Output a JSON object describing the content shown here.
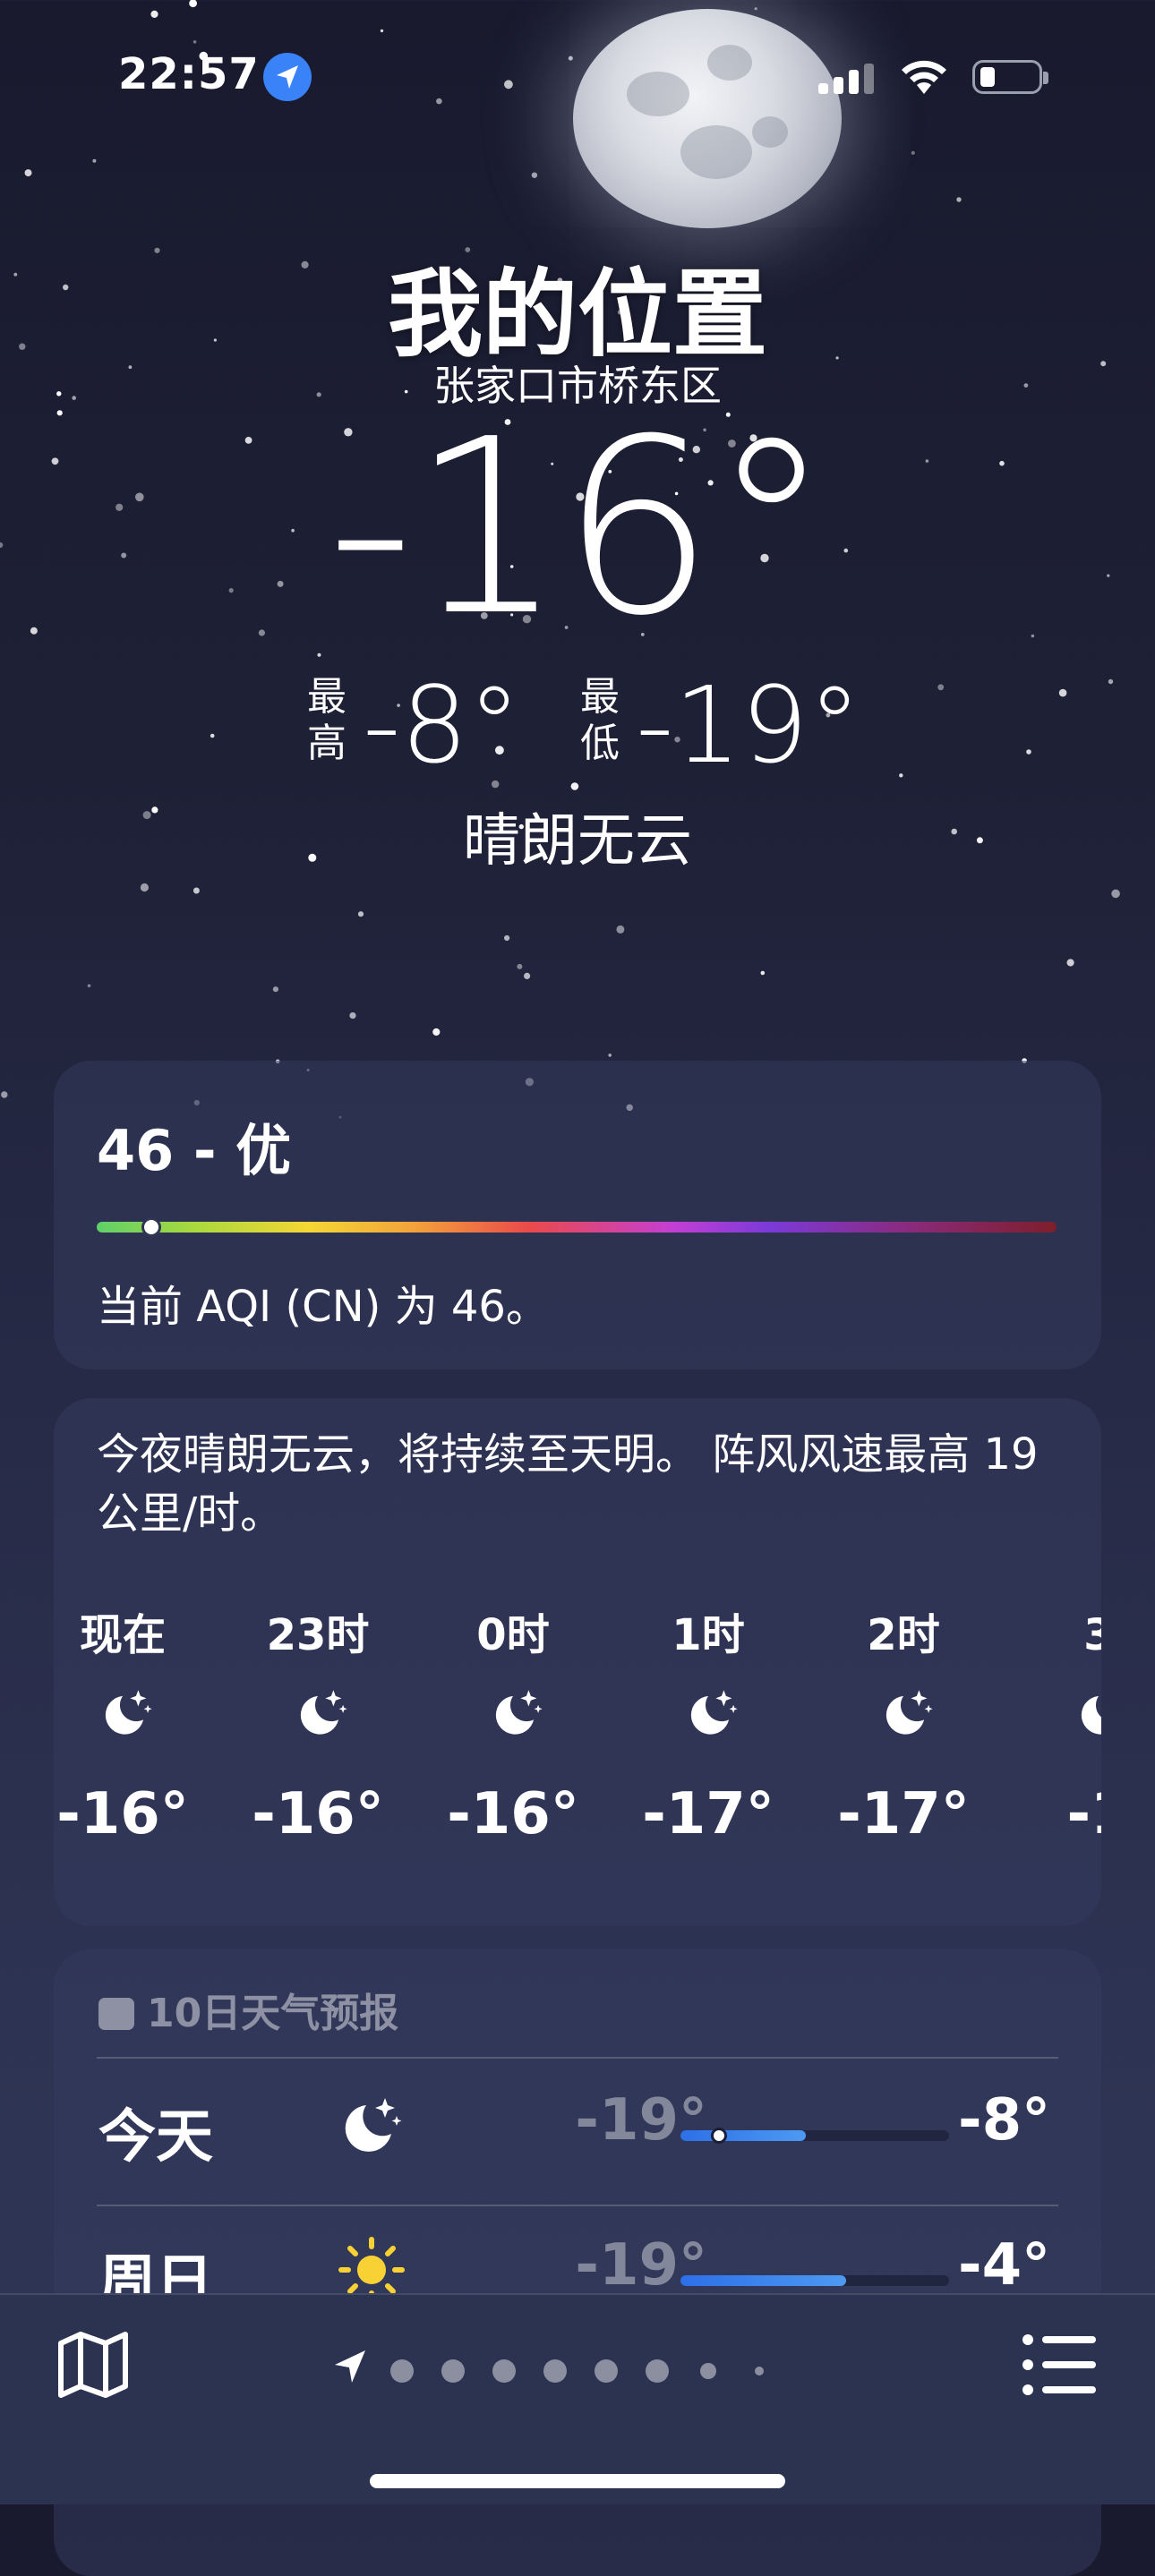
{
  "status_bar": {
    "time": "22:57"
  },
  "header": {
    "city": "我的位置",
    "sublocation": "张家口市桥东区",
    "temperature": "-16°",
    "high_label_1": "最",
    "high_label_2": "高",
    "high": "-8°",
    "low_label_1": "最",
    "low_label_2": "低",
    "low": "-19°",
    "condition": "晴朗无云"
  },
  "aqi": {
    "title": "46 - 优",
    "description": "当前 AQI (CN) 为 46。",
    "value_fraction": 0.05
  },
  "hourly": {
    "summary": "今夜晴朗无云，将持续至天明。 阵风风速最高 19 公里/时。",
    "items": [
      {
        "hour": "现在",
        "icon": "moon-stars-icon",
        "temp": "-16°"
      },
      {
        "hour": "23时",
        "icon": "moon-stars-icon",
        "temp": "-16°"
      },
      {
        "hour": "0时",
        "icon": "moon-stars-icon",
        "temp": "-16°"
      },
      {
        "hour": "1时",
        "icon": "moon-stars-icon",
        "temp": "-17°"
      },
      {
        "hour": "2时",
        "icon": "moon-stars-icon",
        "temp": "-17°"
      },
      {
        "hour": "3",
        "icon": "moon-stars-icon",
        "temp": "-1"
      }
    ]
  },
  "tenday": {
    "header": "10日天气预报",
    "rows": [
      {
        "day": "今天",
        "icon": "moon-stars-icon",
        "low": "-19°",
        "high": "-8°"
      },
      {
        "day": "周日",
        "icon": "sun-icon",
        "low": "-19°",
        "high": "-4°"
      }
    ]
  },
  "toolbar": {
    "page_count": 9,
    "current_page": 1
  },
  "colors": {
    "accent": "#3a82f7",
    "background": "#1e2036",
    "bar_fill": "#2d6fe8"
  }
}
